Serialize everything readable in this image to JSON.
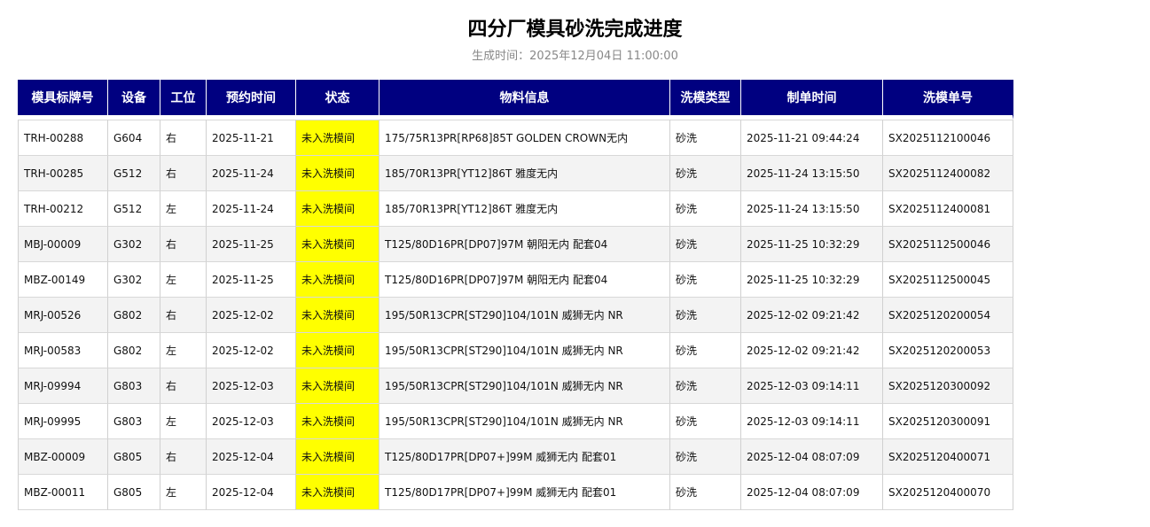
{
  "page": {
    "title": "四分厂模具砂洗完成进度",
    "subtitle": "生成时间：2025年12月04日 11:00:00"
  },
  "colors": {
    "header_bg": "#000080",
    "header_text": "#ffffff",
    "status_highlight": "#ffff00",
    "row_alt": "#f3f3f3"
  },
  "table": {
    "columns": [
      "模具标牌号",
      "设备",
      "工位",
      "预约时间",
      "状态",
      "物料信息",
      "洗模类型",
      "制单时间",
      "洗模单号"
    ],
    "rows": [
      [
        "TRH-00288",
        "G604",
        "右",
        "2025-11-21",
        "未入洗模间",
        "175/75R13PR[RP68]85T GOLDEN CROWN无内",
        "砂洗",
        "2025-11-21 09:44:24",
        "SX2025112100046"
      ],
      [
        "TRH-00285",
        "G512",
        "右",
        "2025-11-24",
        "未入洗模间",
        "185/70R13PR[YT12]86T 雅度无内",
        "砂洗",
        "2025-11-24 13:15:50",
        "SX2025112400082"
      ],
      [
        "TRH-00212",
        "G512",
        "左",
        "2025-11-24",
        "未入洗模间",
        "185/70R13PR[YT12]86T 雅度无内",
        "砂洗",
        "2025-11-24 13:15:50",
        "SX2025112400081"
      ],
      [
        "MBJ-00009",
        "G302",
        "右",
        "2025-11-25",
        "未入洗模间",
        "T125/80D16PR[DP07]97M 朝阳无内 配套04",
        "砂洗",
        "2025-11-25 10:32:29",
        "SX2025112500046"
      ],
      [
        "MBZ-00149",
        "G302",
        "左",
        "2025-11-25",
        "未入洗模间",
        "T125/80D16PR[DP07]97M 朝阳无内 配套04",
        "砂洗",
        "2025-11-25 10:32:29",
        "SX2025112500045"
      ],
      [
        "MRJ-00526",
        "G802",
        "右",
        "2025-12-02",
        "未入洗模间",
        "195/50R13CPR[ST290]104/101N 威狮无内 NR",
        "砂洗",
        "2025-12-02 09:21:42",
        "SX2025120200054"
      ],
      [
        "MRJ-00583",
        "G802",
        "左",
        "2025-12-02",
        "未入洗模间",
        "195/50R13CPR[ST290]104/101N 威狮无内 NR",
        "砂洗",
        "2025-12-02 09:21:42",
        "SX2025120200053"
      ],
      [
        "MRJ-09994",
        "G803",
        "右",
        "2025-12-03",
        "未入洗模间",
        "195/50R13CPR[ST290]104/101N 威狮无内 NR",
        "砂洗",
        "2025-12-03 09:14:11",
        "SX2025120300092"
      ],
      [
        "MRJ-09995",
        "G803",
        "左",
        "2025-12-03",
        "未入洗模间",
        "195/50R13CPR[ST290]104/101N 威狮无内 NR",
        "砂洗",
        "2025-12-03 09:14:11",
        "SX2025120300091"
      ],
      [
        "MBZ-00009",
        "G805",
        "右",
        "2025-12-04",
        "未入洗模间",
        "T125/80D17PR[DP07+]99M 威狮无内 配套01",
        "砂洗",
        "2025-12-04 08:07:09",
        "SX2025120400071"
      ],
      [
        "MBZ-00011",
        "G805",
        "左",
        "2025-12-04",
        "未入洗模间",
        "T125/80D17PR[DP07+]99M 威狮无内 配套01",
        "砂洗",
        "2025-12-04 08:07:09",
        "SX2025120400070"
      ]
    ]
  }
}
